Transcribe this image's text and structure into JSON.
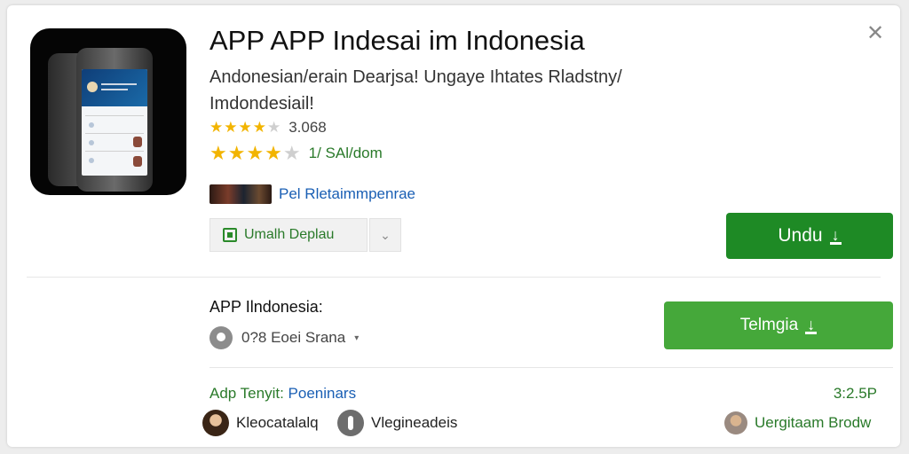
{
  "app": {
    "title": "APP APP Indesai im Indonesia",
    "subtitle_line1": "Andonesian/erain Dearjsa! Ungaye Ihtates Rladstny/",
    "subtitle_line2": "Imdondesiail!",
    "rating1_value": "3.068",
    "rating2_label": "1/ SAl/dom",
    "publisher": "Pel Rletaimmpenrae",
    "icon": "phone-app-icon"
  },
  "actions": {
    "wishlist_label": "Umalh Deplau",
    "wishlist_icon": "bookmark-icon",
    "dropdown_icon": "chevron-down-icon",
    "primary_label": "Undu",
    "secondary_label": "Telmgia",
    "download_icon": "download-icon",
    "close_icon": "close-icon"
  },
  "section": {
    "title": "APP Ilndonesia:",
    "location_label": "0?8 Eoei Srana",
    "location_icon": "location-icon",
    "list_label_green": "Adp Tenyit:",
    "list_label_blue": "Poeninars",
    "list_value": "3:2.5P"
  },
  "people": [
    {
      "name": "Kleocatalalq",
      "icon": "avatar-photo"
    },
    {
      "name": "Vlegineadeis",
      "icon": "info-avatar-icon"
    },
    {
      "name": "Uergitaam Brodw",
      "icon": "avatar-photo"
    }
  ],
  "colors": {
    "primary_green": "#1e8a25",
    "secondary_green": "#45a83a",
    "link_blue": "#1a5fb4",
    "star_gold": "#f2b400"
  }
}
